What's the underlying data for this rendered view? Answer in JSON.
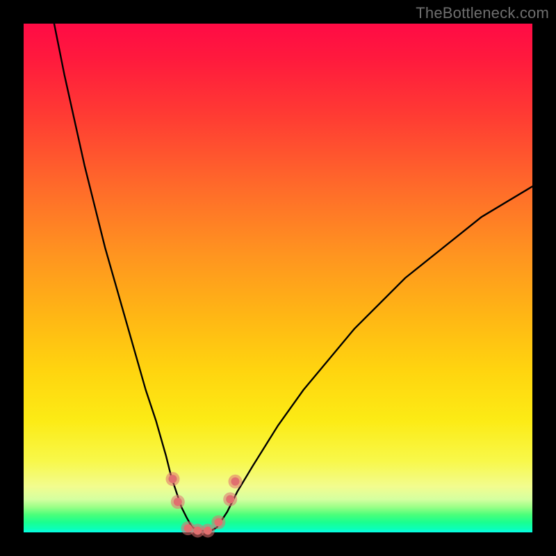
{
  "watermark": {
    "text": "TheBottleneck.com"
  },
  "chart_data": {
    "type": "line",
    "title": "",
    "xlabel": "",
    "ylabel": "",
    "xlim": [
      0,
      100
    ],
    "ylim": [
      0,
      100
    ],
    "grid": false,
    "legend": false,
    "background_gradient": {
      "direction": "top-to-bottom",
      "stops": [
        {
          "pos": 0.0,
          "color": "#ff0b45"
        },
        {
          "pos": 0.45,
          "color": "#ff9320"
        },
        {
          "pos": 0.78,
          "color": "#fceb15"
        },
        {
          "pos": 0.95,
          "color": "#9cff88"
        },
        {
          "pos": 1.0,
          "color": "#06ffe6"
        }
      ]
    },
    "series": [
      {
        "name": "bottleneck-curve",
        "color": "#000000",
        "x": [
          6,
          8,
          10,
          12,
          14,
          16,
          18,
          20,
          22,
          24,
          26,
          28,
          29,
          30,
          31,
          32,
          33,
          34,
          35,
          36,
          37,
          38,
          40,
          42,
          45,
          50,
          55,
          60,
          65,
          70,
          75,
          80,
          85,
          90,
          95,
          100
        ],
        "y": [
          100,
          90,
          81,
          72,
          64,
          56,
          49,
          42,
          35,
          28,
          22,
          15,
          11,
          8,
          5,
          3,
          1.2,
          0.4,
          0.3,
          0.3,
          0.4,
          1.0,
          4,
          8,
          13,
          21,
          28,
          34,
          40,
          45,
          50,
          54,
          58,
          62,
          65,
          68
        ]
      }
    ],
    "markers": {
      "name": "data-points",
      "color": "#e06f6f",
      "radius_outer": 10,
      "radius_inner": 6,
      "points": [
        {
          "x": 29.3,
          "y": 10.5
        },
        {
          "x": 30.3,
          "y": 6.0
        },
        {
          "x": 32.3,
          "y": 0.8
        },
        {
          "x": 34.2,
          "y": 0.35
        },
        {
          "x": 36.2,
          "y": 0.35
        },
        {
          "x": 38.3,
          "y": 2.0
        },
        {
          "x": 40.6,
          "y": 6.5
        },
        {
          "x": 41.6,
          "y": 10.0
        }
      ]
    }
  }
}
